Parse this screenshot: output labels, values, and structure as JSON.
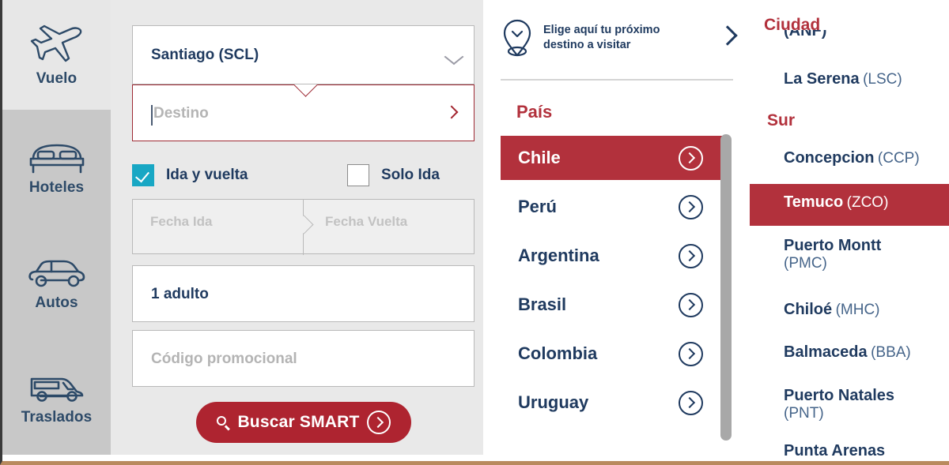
{
  "sidebar": {
    "items": [
      {
        "label": "Vuelo",
        "icon": "airplane-icon",
        "active": true
      },
      {
        "label": "Hoteles",
        "icon": "bed-icon",
        "active": false
      },
      {
        "label": "Autos",
        "icon": "car-icon",
        "active": false
      },
      {
        "label": "Traslados",
        "icon": "van-icon",
        "active": false
      }
    ]
  },
  "form": {
    "origin": {
      "value": "Santiago (SCL)",
      "icon": "chevron-down-icon"
    },
    "destination": {
      "placeholder": "Destino",
      "value": "",
      "icon": "chevron-right-icon"
    },
    "trip_type": {
      "round_trip_label": "Ida y vuelta",
      "round_trip_checked": true,
      "one_way_label": "Solo Ida",
      "one_way_checked": false
    },
    "dates": {
      "depart_placeholder": "Fecha Ida",
      "return_placeholder": "Fecha Vuelta",
      "depart_value": "",
      "return_value": ""
    },
    "passengers": {
      "value": "1 adulto"
    },
    "promo": {
      "placeholder": "Código promocional",
      "value": ""
    },
    "search_button": {
      "label": "Buscar SMART",
      "icon": "magnifier-icon"
    }
  },
  "dropdown": {
    "header": {
      "line1": "Elige aquí tu próximo",
      "line2": "destino a visitar",
      "icon": "map-pin-icon",
      "chevron": "chevron-right-icon"
    },
    "country_section_label": "País",
    "countries": [
      {
        "name": "Chile",
        "selected": true
      },
      {
        "name": "Perú",
        "selected": false
      },
      {
        "name": "Argentina",
        "selected": false
      },
      {
        "name": "Brasil",
        "selected": false
      },
      {
        "name": "Colombia",
        "selected": false
      },
      {
        "name": "Uruguay",
        "selected": false
      }
    ],
    "city_section_label": "Ciudad",
    "city_partial_top": "(ANF)",
    "city_partial_bottom": "Punta Arenas",
    "city_groups": [
      {
        "label": "",
        "cities": [
          {
            "name": "La Serena",
            "code": "(LSC)",
            "selected": false
          }
        ]
      },
      {
        "label": "Sur",
        "cities": [
          {
            "name": "Concepcion",
            "code": "(CCP)",
            "selected": false
          },
          {
            "name": "Temuco",
            "code": "(ZCO)",
            "selected": true
          },
          {
            "name": "Puerto Montt",
            "code": "(PMC)",
            "selected": false
          },
          {
            "name": "Chiloé",
            "code": "(MHC)",
            "selected": false
          },
          {
            "name": "Balmaceda",
            "code": "(BBA)",
            "selected": false
          },
          {
            "name": "Puerto Natales",
            "code": "(PNT)",
            "selected": false
          }
        ]
      }
    ]
  },
  "colors": {
    "brand_red": "#b2313c",
    "button_red": "#ae2430",
    "navy": "#1f3a5f",
    "teal": "#18a7c4",
    "sidebar_gray": "#c8c8c8",
    "panel_gray": "#e9e9e9"
  }
}
